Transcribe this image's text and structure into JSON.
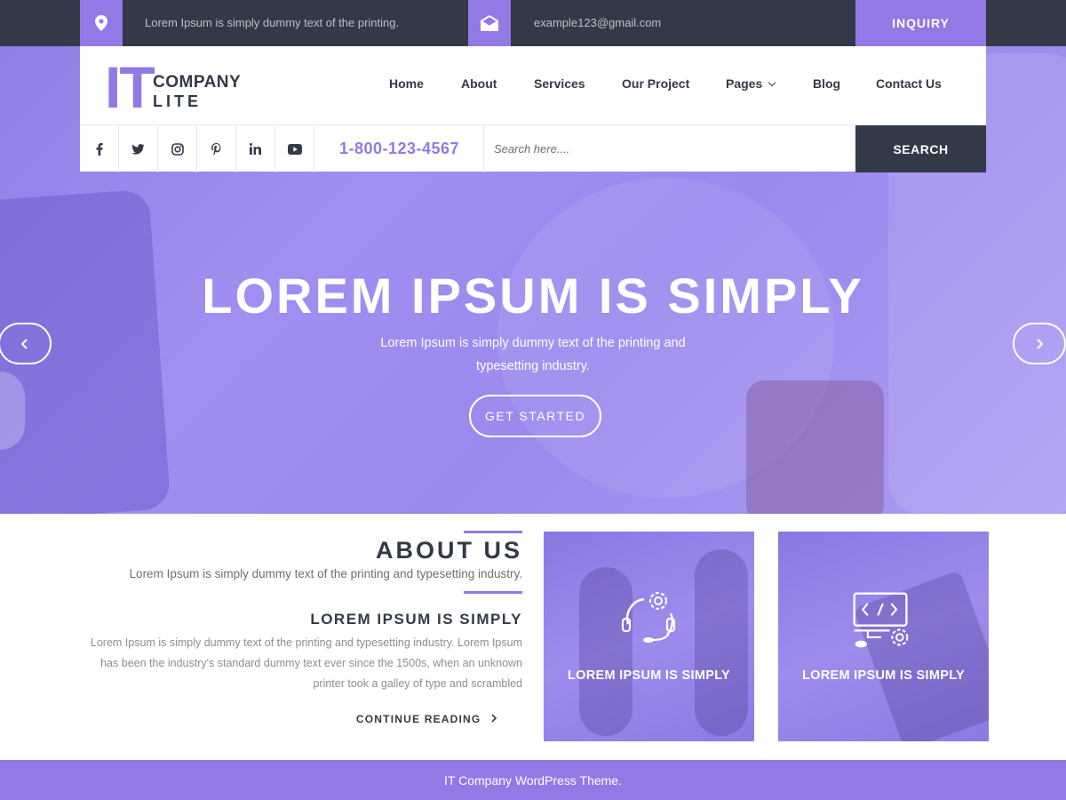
{
  "colors": {
    "accent": "#9279e6",
    "dark": "#333a47",
    "white": "#ffffff"
  },
  "topbar": {
    "location_icon": "map-pin-icon",
    "address": "Lorem Ipsum is simply dummy text of the printing.",
    "mail_icon": "envelope-open-icon",
    "email": "example123@gmail.com",
    "inquiry_label": "INQUIRY"
  },
  "logo": {
    "mark": "IT",
    "line1": "COMPANY",
    "line2": "LITE"
  },
  "nav": {
    "items": [
      {
        "label": "Home"
      },
      {
        "label": "About"
      },
      {
        "label": "Services"
      },
      {
        "label": "Our Project"
      },
      {
        "label": "Pages",
        "icon": "chevron-down-icon"
      },
      {
        "label": "Blog"
      },
      {
        "label": "Contact Us"
      }
    ]
  },
  "social": [
    {
      "name": "facebook-icon"
    },
    {
      "name": "twitter-icon"
    },
    {
      "name": "instagram-icon"
    },
    {
      "name": "pinterest-icon"
    },
    {
      "name": "linkedin-icon"
    },
    {
      "name": "youtube-icon"
    }
  ],
  "contact": {
    "phone": "1-800-123-4567"
  },
  "search": {
    "placeholder": "Search here....",
    "button_label": "SEARCH"
  },
  "hero": {
    "title": "LOREM IPSUM IS SIMPLY",
    "text": "Lorem Ipsum is simply dummy text of the printing and typesetting industry.",
    "button_label": "GET STARTED",
    "prev_icon": "chevron-left-icon",
    "next_icon": "chevron-right-icon"
  },
  "about": {
    "title": "ABOUT US",
    "subtitle": "Lorem Ipsum is simply dummy text of the printing and typesetting industry.",
    "heading": "LOREM IPSUM IS SIMPLY",
    "paragraph": "Lorem Ipsum is simply dummy text of the printing and typesetting industry. Lorem Ipsum has been the industry's standard dummy text ever since the 1500s, when an unknown printer took a galley of type and scrambled",
    "continue_label": "CONTINUE READING",
    "continue_icon": "chevron-right-icon"
  },
  "cards": [
    {
      "label": "LOREM IPSUM IS SIMPLY",
      "icon": "support-gear-icon"
    },
    {
      "label": "LOREM IPSUM IS SIMPLY",
      "icon": "code-monitor-icon"
    }
  ],
  "footer": {
    "text": "IT Company WordPress Theme."
  }
}
